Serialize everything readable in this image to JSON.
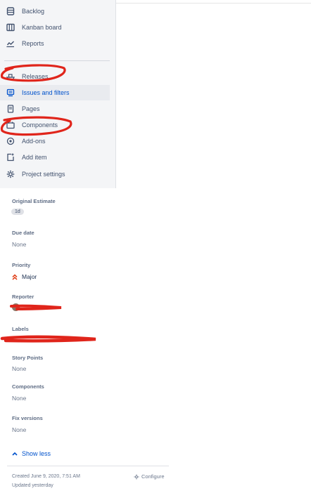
{
  "sidebar": {
    "items": [
      {
        "label": "Backlog",
        "icon": "backlog-icon"
      },
      {
        "label": "Kanban board",
        "icon": "board-icon"
      },
      {
        "label": "Reports",
        "icon": "reports-icon"
      },
      {
        "label": "Releases",
        "icon": "ship-icon"
      },
      {
        "label": "Issues and filters",
        "icon": "issues-icon"
      },
      {
        "label": "Pages",
        "icon": "page-icon"
      },
      {
        "label": "Components",
        "icon": "component-icon"
      },
      {
        "label": "Add-ons",
        "icon": "addon-icon"
      },
      {
        "label": "Add item",
        "icon": "add-item-icon"
      },
      {
        "label": "Project settings",
        "icon": "gear-icon"
      }
    ],
    "selected": "Issues and filters"
  },
  "details": {
    "original_estimate": {
      "label": "Original Estimate",
      "value": "1d"
    },
    "due_date": {
      "label": "Due date",
      "value": "None"
    },
    "priority": {
      "label": "Priority",
      "value": "Major"
    },
    "reporter": {
      "label": "Reporter"
    },
    "labels": {
      "label": "Labels"
    },
    "story_points": {
      "label": "Story Points",
      "value": "None"
    },
    "components": {
      "label": "Components",
      "value": "None"
    },
    "fix_versions": {
      "label": "Fix versions",
      "value": "None"
    },
    "show_less": "Show less"
  },
  "footer": {
    "created": "Created June 9, 2020, 7:51 AM",
    "updated": "Updated yesterday",
    "configure": "Configure"
  },
  "colors": {
    "accent": "#0052cc",
    "annotation_red": "#e0251b",
    "priority_red": "#de350b"
  }
}
